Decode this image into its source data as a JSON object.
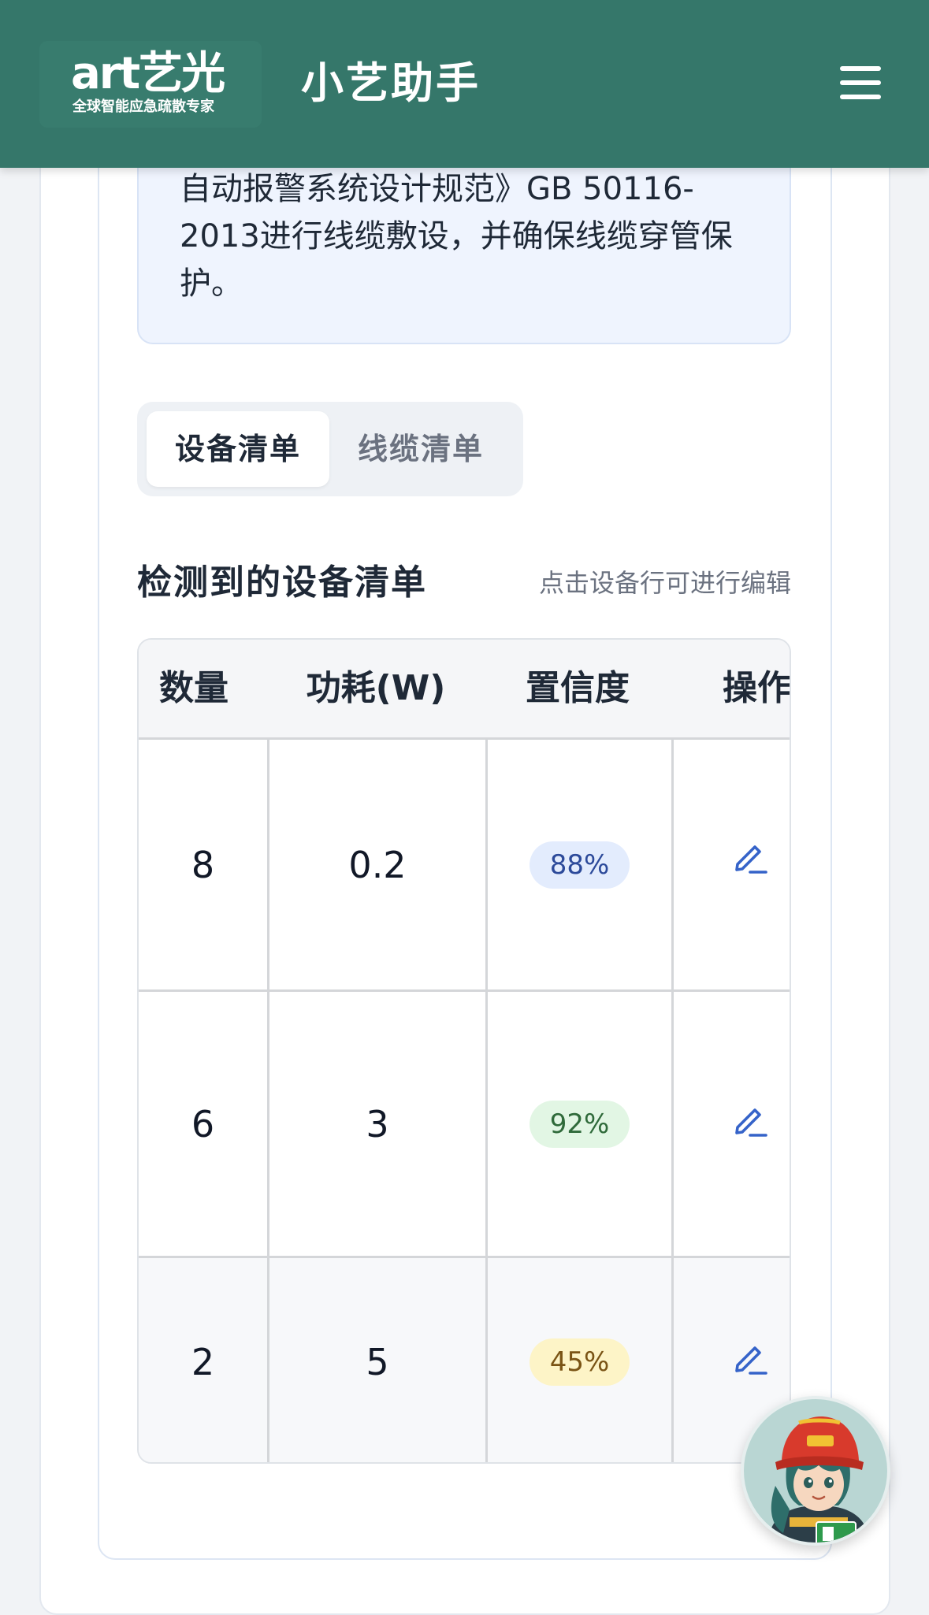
{
  "header": {
    "logo_main": "art艺光",
    "logo_sub": "全球智能应急疏散专家",
    "title": "小艺助手",
    "menu_icon": "hamburger-menu-icon",
    "background": "#35776a"
  },
  "answer": {
    "lines": [
      "自动报警系统设计规范》GB 50116-",
      "2013进行线缆敷设，并确保线缆穿管保",
      "护。"
    ]
  },
  "tabs": [
    {
      "label": "设备清单",
      "active": true
    },
    {
      "label": "线缆清单",
      "active": false
    }
  ],
  "section": {
    "title": "检测到的设备清单",
    "hint": "点击设备行可进行编辑"
  },
  "table": {
    "headers": [
      "数量",
      "功耗(W)",
      "置信度",
      "操作"
    ],
    "rows": [
      {
        "qty": "8",
        "power": "0.2",
        "confidence": "88%",
        "badge_bg": "#e3ecfd",
        "badge_fg": "#2c4a9a",
        "action_icon": "edit-pencil-icon"
      },
      {
        "qty": "6",
        "power": "3",
        "confidence": "92%",
        "badge_bg": "#e2f6e4",
        "badge_fg": "#2f6a3a",
        "action_icon": "edit-pencil-icon"
      },
      {
        "qty": "2",
        "power": "5",
        "confidence": "45%",
        "badge_bg": "#fdf4c7",
        "badge_fg": "#7a5415",
        "action_icon": "edit-pencil-icon"
      }
    ]
  },
  "colors": {
    "accent": "#35776a",
    "edit_icon": "#3563c9"
  },
  "assistant_avatar_icon": "firefighter-avatar-icon"
}
